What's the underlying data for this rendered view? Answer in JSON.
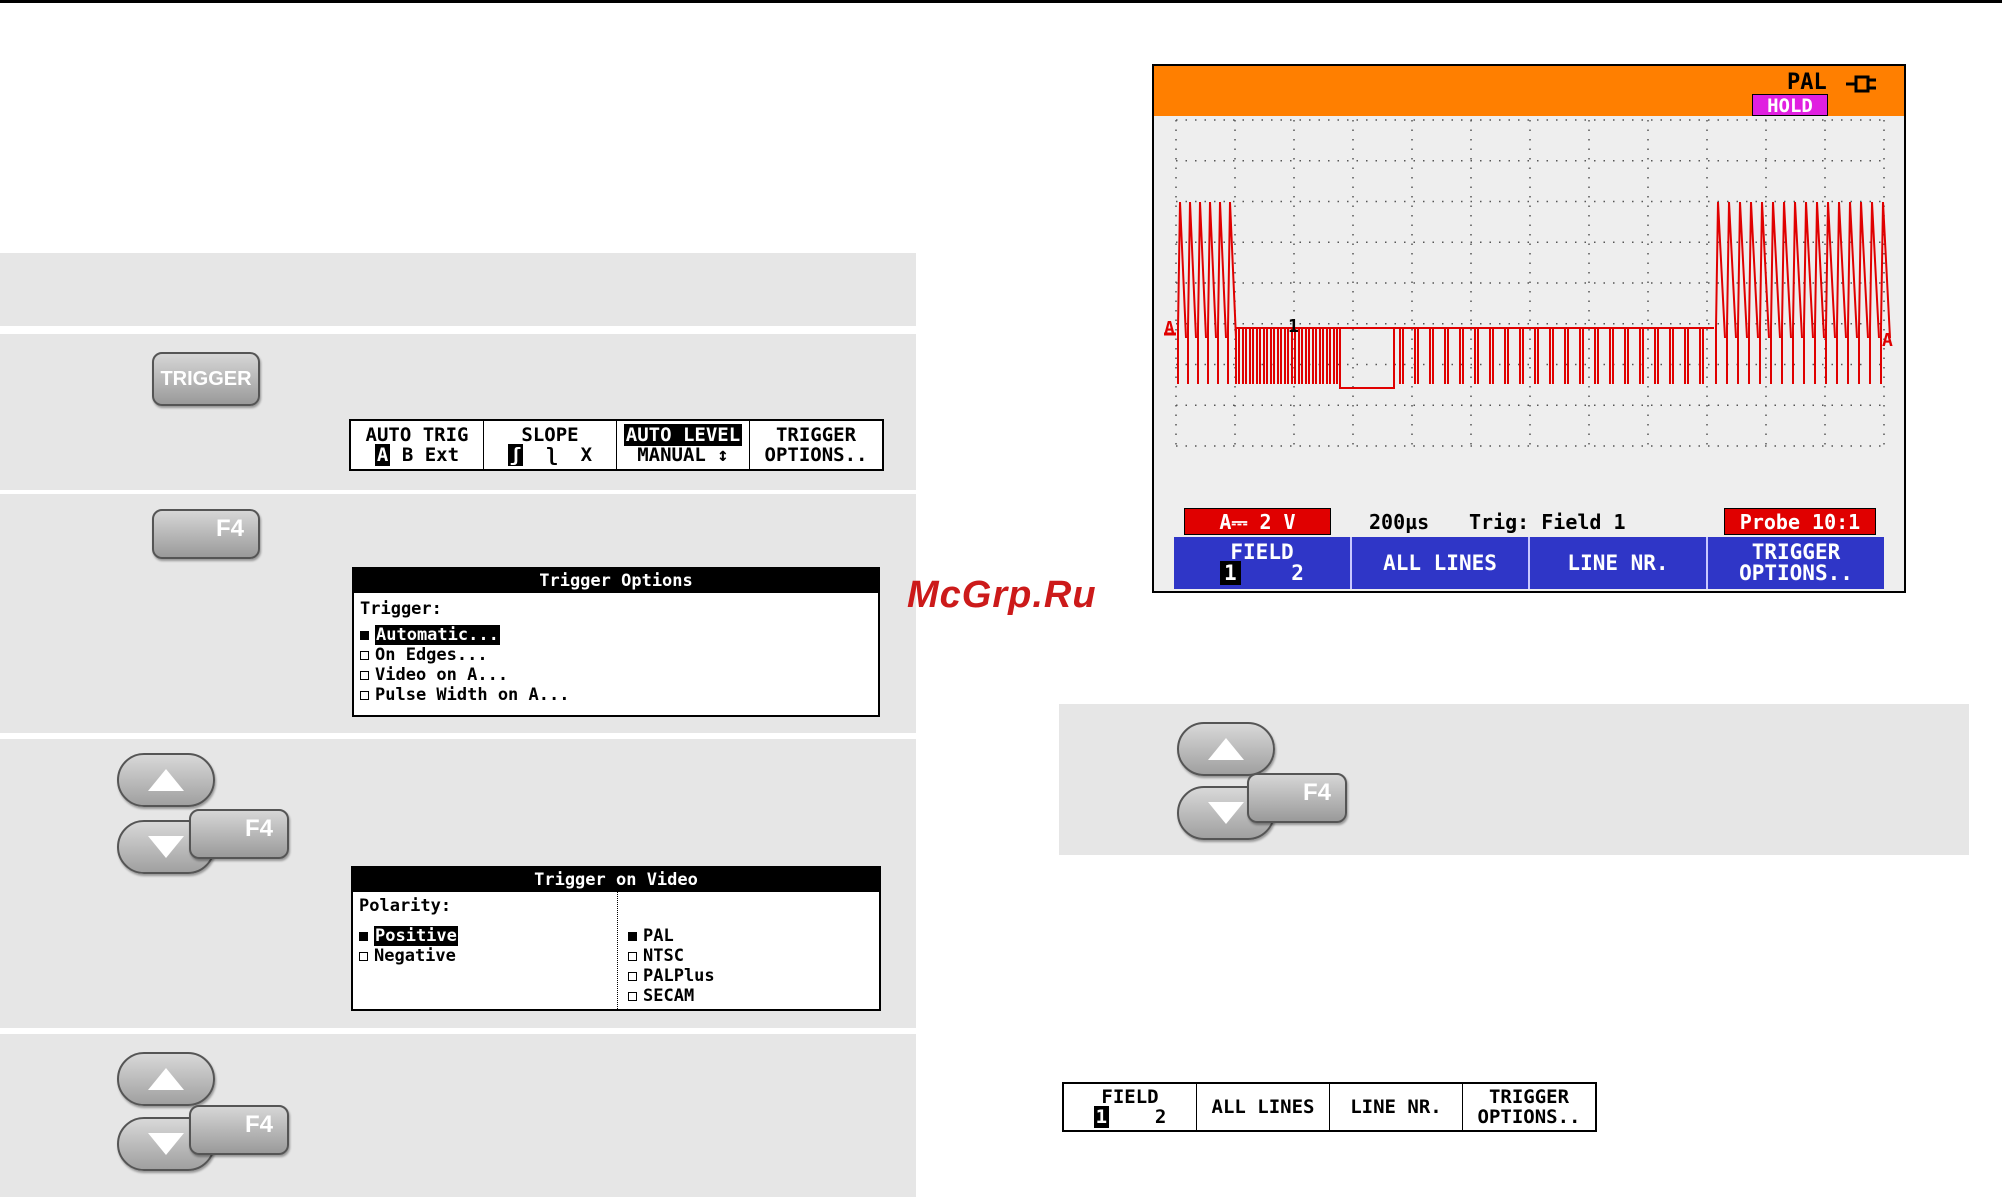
{
  "buttons": {
    "trigger": "TRIGGER",
    "f4": "F4"
  },
  "trigger_menu": {
    "auto_trig": {
      "title": "AUTO TRIG",
      "a": "A",
      "b": "B",
      "ext": "Ext"
    },
    "slope": {
      "title": "SLOPE",
      "rise": "ʃ",
      "fall": "ʅ",
      "both": "X"
    },
    "auto_level": {
      "title": "AUTO LEVEL",
      "sub": "MANUAL ↕"
    },
    "options": {
      "line1": "TRIGGER",
      "line2": "OPTIONS.."
    }
  },
  "trigger_options_dialog": {
    "title": "Trigger Options",
    "label": "Trigger:",
    "options": [
      "Automatic...",
      "On Edges...",
      "Video on A...",
      "Pulse Width on A..."
    ],
    "selected": 0
  },
  "video_dialog": {
    "title": "Trigger on Video",
    "polarity_label": "Polarity:",
    "polarity": [
      "Positive",
      "Negative"
    ],
    "polarity_selected": 0,
    "systems": [
      "PAL",
      "NTSC",
      "PALPlus",
      "SECAM"
    ],
    "system_selected": 0
  },
  "scope": {
    "standard": "PAL",
    "hold": "HOLD",
    "channel_marker": "A",
    "trigger_marker": "1",
    "range": "A⎓ 2 V",
    "timebase": "200µs",
    "trig": "Trig: Field 1",
    "probe": "Probe 10:1",
    "colors": {
      "header": "#ff7f00",
      "trace": "#e00000",
      "menu": "#2f36c7",
      "hold": "#e020e0"
    }
  },
  "field_menu": {
    "field": {
      "title": "FIELD",
      "one": "1",
      "two": "2"
    },
    "all_lines": "ALL LINES",
    "line_nr": "LINE NR.",
    "options": {
      "line1": "TRIGGER",
      "line2": "OPTIONS.."
    }
  },
  "watermark": "McGrp.Ru"
}
